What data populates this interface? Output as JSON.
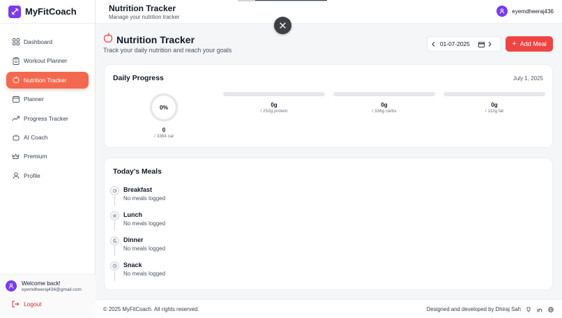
{
  "brand": {
    "name": "MyFitCoach"
  },
  "sidebar": {
    "items": [
      {
        "label": "Dashboard",
        "icon": "grid-icon"
      },
      {
        "label": "Workout Planner",
        "icon": "clipboard-icon"
      },
      {
        "label": "Nutrition Tracker",
        "icon": "apple-icon",
        "active": true
      },
      {
        "label": "Planner",
        "icon": "calendar-icon"
      },
      {
        "label": "Progress Tracker",
        "icon": "trending-up-icon"
      },
      {
        "label": "AI Coach",
        "icon": "bot-icon"
      },
      {
        "label": "Premium",
        "icon": "crown-icon"
      },
      {
        "label": "Profile",
        "icon": "user-icon"
      }
    ],
    "welcome": "Welcome back!",
    "email": "eyemdheeraj436@gmail.com",
    "logout": "Logout"
  },
  "header": {
    "title": "Nutrition Tracker",
    "subtitle": "Manage your nutrition tracker",
    "username": "eyemdheeraj436"
  },
  "page": {
    "title": "Nutrition Tracker",
    "subtitle": "Track your daily nutrition and reach your goals",
    "date_value": "01-07-2025",
    "add_meal": "Add Meal"
  },
  "progress": {
    "title": "Daily Progress",
    "date": "July 1, 2025",
    "percent": "0%",
    "percent_value": 0,
    "calories": "0",
    "calorie_goal": "/ 3364 cal",
    "macros": [
      {
        "value": "0g",
        "goal": "/ 252g protein",
        "fraction": 0
      },
      {
        "value": "0g",
        "goal": "/ 336g carbs",
        "fraction": 0
      },
      {
        "value": "0g",
        "goal": "/ 112g fat",
        "fraction": 0
      }
    ]
  },
  "meals": {
    "title": "Today's Meals",
    "items": [
      {
        "name": "Breakfast",
        "status": "No meals logged",
        "icon": "sunrise-icon"
      },
      {
        "name": "Lunch",
        "status": "No meals logged",
        "icon": "sun-icon"
      },
      {
        "name": "Dinner",
        "status": "No meals logged",
        "icon": "moon-icon"
      },
      {
        "name": "Snack",
        "status": "No meals logged",
        "icon": "clock-icon"
      }
    ]
  },
  "footer": {
    "copyright": "© 2025 MyFitCoach. All rights reserved.",
    "credit": "Designed and developed by Dhiraj Sah"
  },
  "colors": {
    "accent": "#ef4444",
    "brand": "#7c3aed",
    "active_nav": "#f26950"
  }
}
